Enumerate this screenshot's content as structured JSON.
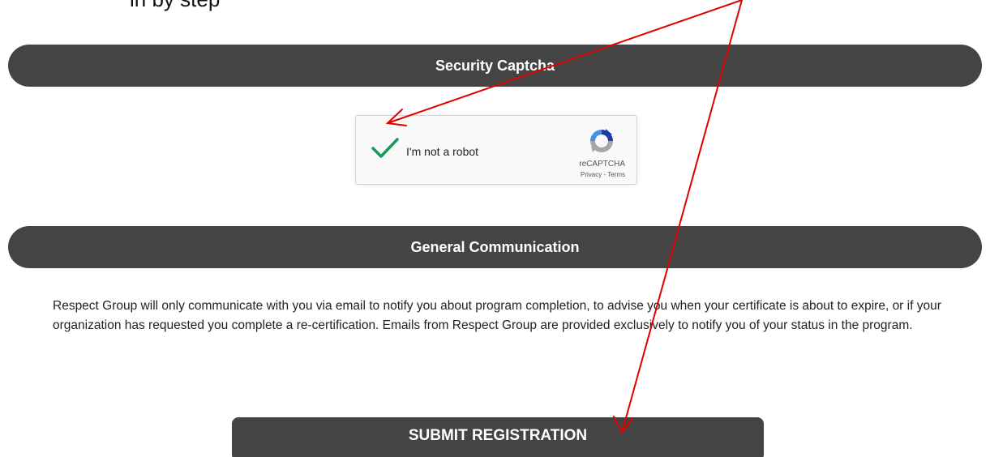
{
  "top_partial_text": "in by step",
  "captcha_section": {
    "title": "Security Captcha"
  },
  "recaptcha": {
    "label": "I'm not a robot",
    "brand": "reCAPTCHA",
    "privacy": "Privacy",
    "separator": " - ",
    "terms": "Terms",
    "checked": true,
    "check_color": "#0f9d58"
  },
  "general_section": {
    "title": "General Communication",
    "body": "Respect Group will only communicate with you via email to notify you about program completion, to advise you when your certificate is about to expire, or if your organization has requested you complete a re-certification. Emails from Respect Group are provided exclusively to notify you of your status in the program."
  },
  "submit": {
    "label": "SUBMIT REGISTRATION"
  },
  "colors": {
    "bar_background": "#444444",
    "annotation_arrow": "#e00000"
  }
}
